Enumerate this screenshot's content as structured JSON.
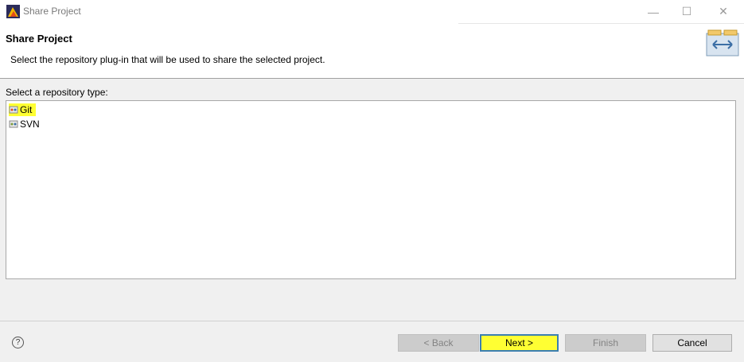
{
  "window": {
    "title": "Share Project",
    "minimize_symbol": "—",
    "maximize_symbol": "☐",
    "close_symbol": "✕"
  },
  "header": {
    "title": "Share Project",
    "description": "Select the repository plug-in that will be used to share the selected project."
  },
  "content": {
    "label": "Select a repository type:",
    "items": [
      {
        "label": "Git",
        "icon": "git-repo-icon",
        "highlighted": true
      },
      {
        "label": "SVN",
        "icon": "svn-repo-icon",
        "highlighted": false
      }
    ]
  },
  "footer": {
    "help_symbol": "?",
    "back_label": "< Back",
    "next_label": "Next >",
    "finish_label": "Finish",
    "cancel_label": "Cancel"
  },
  "colors": {
    "highlight": "#ffff33",
    "focus_border": "#3c7fb1",
    "panel_background": "#f0f0f0"
  }
}
